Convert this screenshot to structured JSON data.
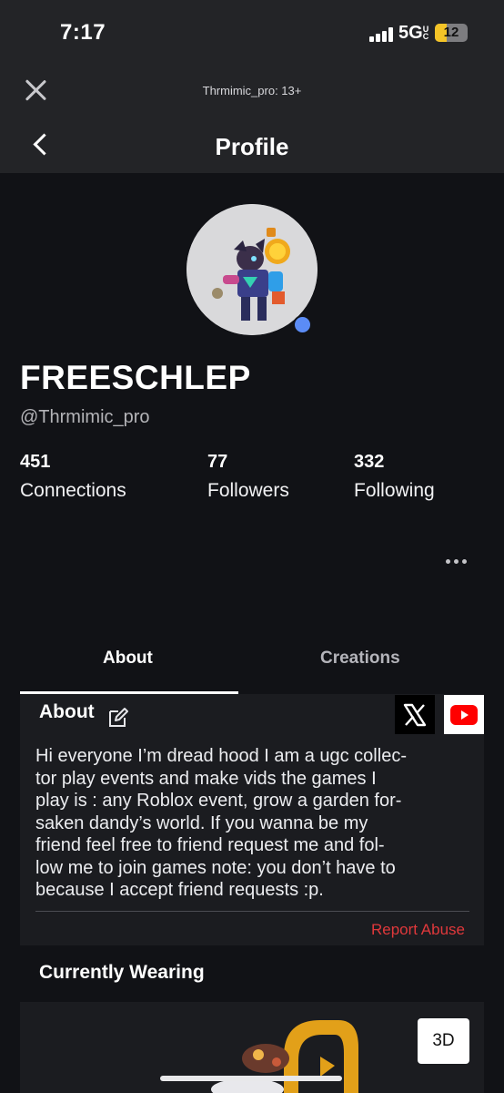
{
  "status_bar": {
    "time": "7:17",
    "network": "5G",
    "network_suffix": "UC",
    "battery": "12",
    "battery_level": 0.12
  },
  "browser": {
    "title": "Thrmimic_pro: 13+"
  },
  "nav": {
    "title": "Profile"
  },
  "profile": {
    "display_name": "FREESCHLEP",
    "username": "@Thrmimic_pro",
    "online": true,
    "stats": [
      {
        "value": "451",
        "label": "Connections"
      },
      {
        "value": "77",
        "label": "Followers"
      },
      {
        "value": "332",
        "label": "Following"
      }
    ]
  },
  "tabs": [
    {
      "label": "About",
      "active": true
    },
    {
      "label": "Creations",
      "active": false
    }
  ],
  "about": {
    "heading": "About",
    "bio_lines": [
      "Hi everyone I’m dread hood I am a ugc collec-",
      "tor play events and make vids the games I",
      "play is : any Roblox event, grow a garden for-",
      "saken dandy’s world. If you wanna be my",
      "friend feel free to friend request me and fol-",
      "low me to join games note: you don’t have to",
      "because I accept friend requests :p."
    ],
    "social_links": [
      "x-icon",
      "youtube-icon"
    ],
    "report_label": "Report Abuse"
  },
  "wearing": {
    "heading": "Currently Wearing",
    "view_3d_label": "3D"
  },
  "colors": {
    "background": "#111216",
    "card": "#1b1c20",
    "online": "#5b8cf6",
    "report": "#e0383b",
    "battery": "#f4c427"
  }
}
